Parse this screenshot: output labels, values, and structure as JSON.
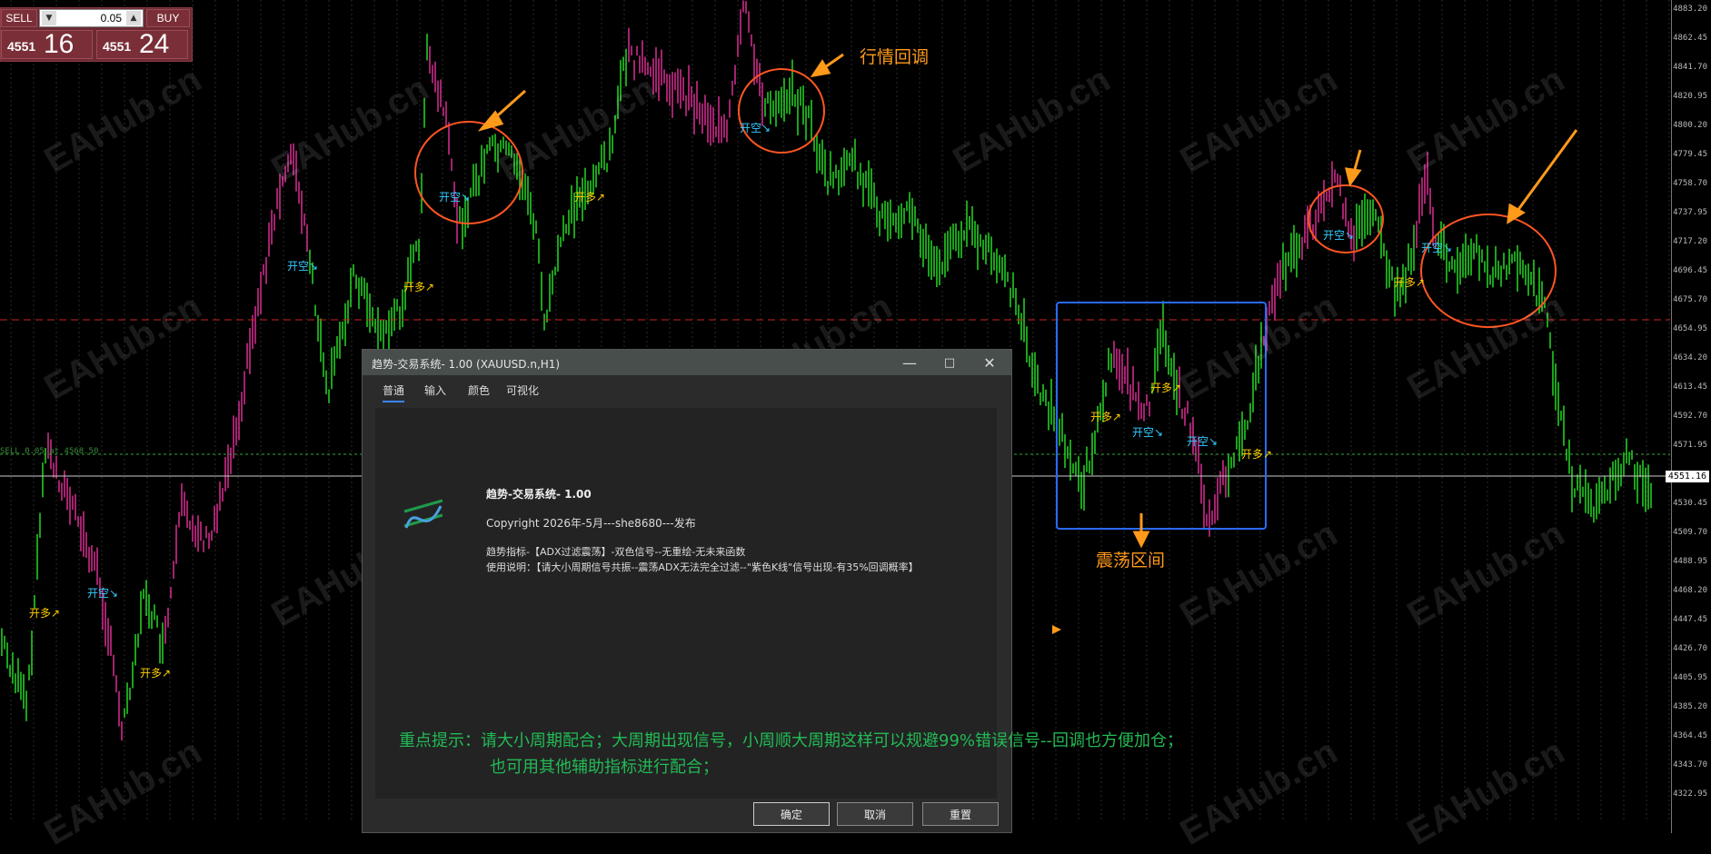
{
  "chart": {
    "symbol": "XAUUSD.n",
    "current_price": "4551.16",
    "price_ticks": [
      "4883.20",
      "4862.45",
      "4841.70",
      "4820.95",
      "4800.20",
      "4779.45",
      "4758.70",
      "4737.95",
      "4717.20",
      "4696.45",
      "4675.70",
      "4654.95",
      "4634.20",
      "4613.45",
      "4592.70",
      "4571.95",
      "4551.16",
      "4530.45",
      "4509.70",
      "4488.95",
      "4468.20",
      "4447.45",
      "4426.70",
      "4405.95",
      "4385.20",
      "4364.45",
      "4343.70",
      "4322.95"
    ],
    "sell_line_label": "SELL 0.05 at 4568.50",
    "colors": {
      "bull": "#22cc22",
      "bear": "#cc2a8a",
      "resistance": "#cc2222",
      "entry": "#33aa33"
    }
  },
  "trade_panel": {
    "sell_label": "SELL",
    "buy_label": "BUY",
    "volume": "0.05",
    "sell_price_small": "4551",
    "sell_price_big": "16",
    "buy_price_small": "4551",
    "buy_price_big": "24"
  },
  "watermark": "EAHub.cn",
  "signals": {
    "long": "开多↗",
    "short": "开空↘"
  },
  "annotations": {
    "pullback": "行情回调",
    "ranging": "震荡区间"
  },
  "dialog": {
    "title": "趋势-交易系统- 1.00 (XAUUSD.n,H1)",
    "tabs": [
      "普通",
      "输入",
      "颜色",
      "可视化"
    ],
    "product_name": "趋势-交易系统- 1.00",
    "copyright": "Copyright 2026年-5月---she8680---发布",
    "desc_line1": "趋势指标-【ADX过滤震荡】-双色信号--无重绘-无未来函数",
    "desc_line2": "使用说明：【请大小周期信号共振--震荡ADX无法完全过滤--\"紫色K线\"信号出现-有35%回调概率】",
    "tip_line1": "重点提示：请大小周期配合；大周期出现信号，小周顺大周期这样可以规避99%错误信号--回调也方便加仓；",
    "tip_line2": "也可用其他辅助指标进行配合；",
    "ok": "确定",
    "cancel": "取消",
    "reset": "重置"
  }
}
